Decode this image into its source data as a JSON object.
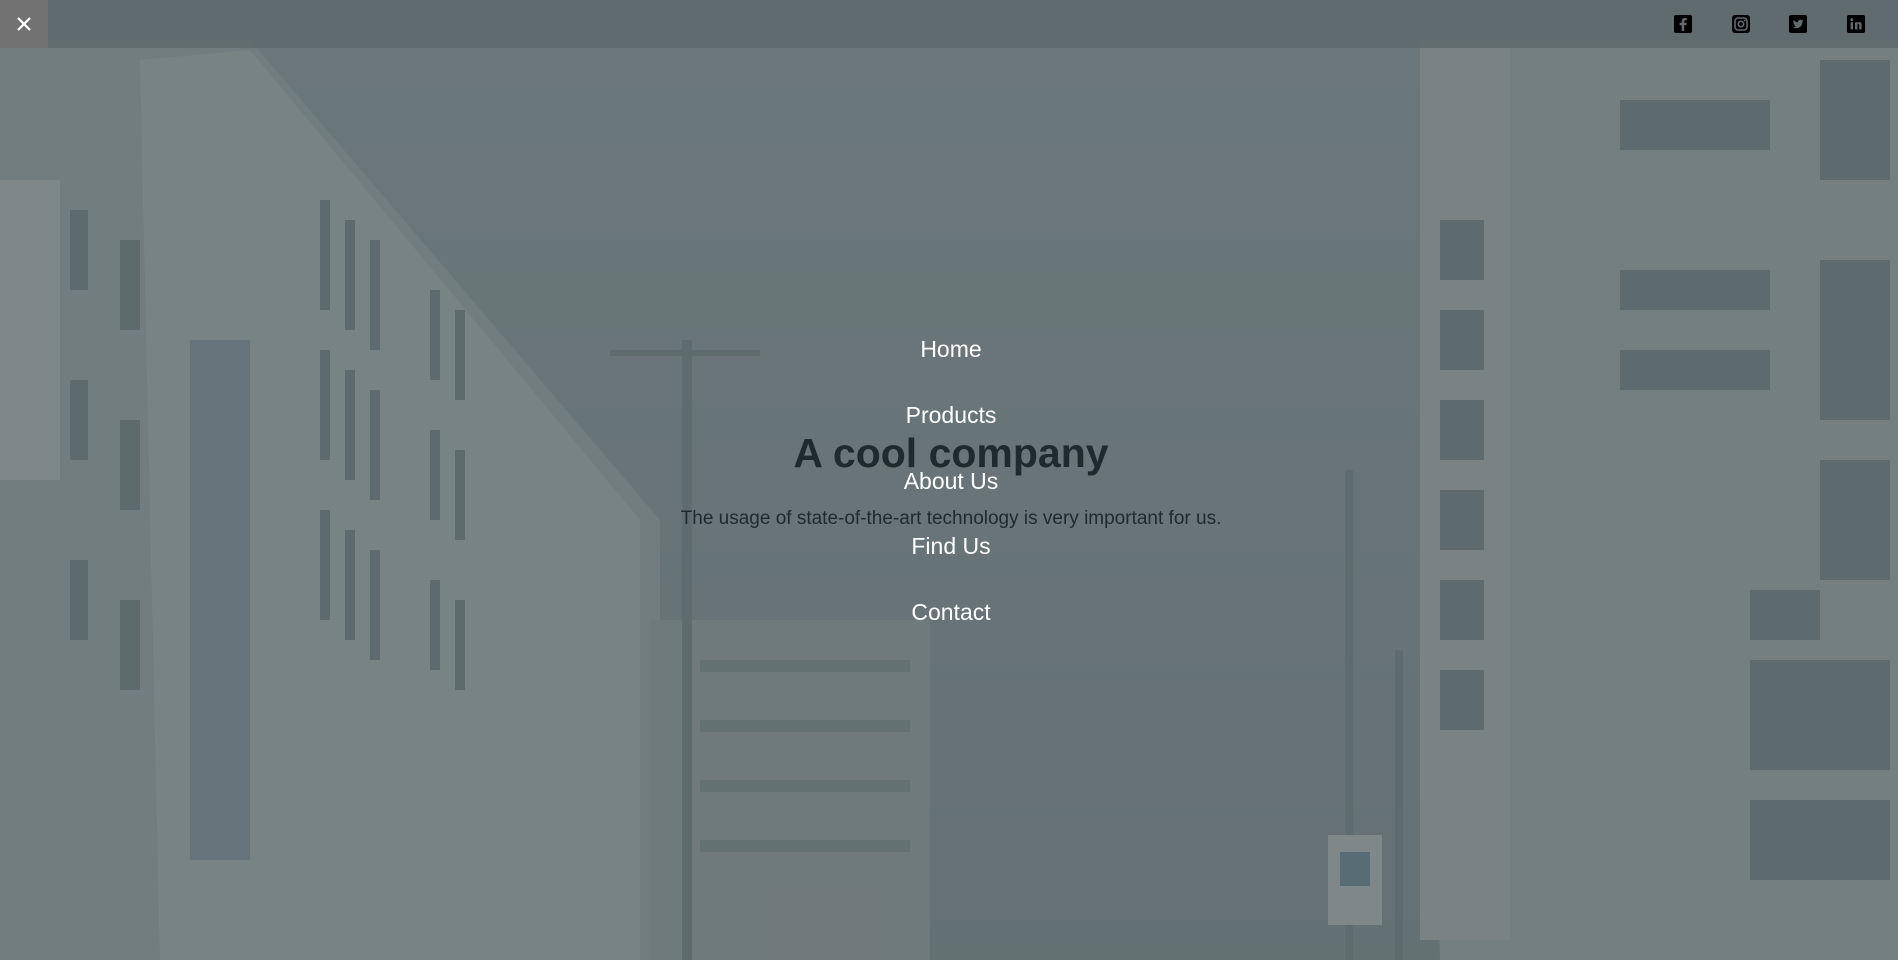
{
  "nav": {
    "close_label": "×",
    "items": [
      {
        "label": "Home"
      },
      {
        "label": "Products"
      },
      {
        "label": "About Us"
      },
      {
        "label": "Find Us"
      },
      {
        "label": "Contact"
      }
    ]
  },
  "social": {
    "icons": [
      "facebook-icon",
      "instagram-icon",
      "twitter-icon",
      "linkedin-icon"
    ]
  },
  "hero": {
    "title": "A cool company",
    "subtitle": "The usage of state-of-the-art technology is very important for us."
  },
  "colors": {
    "overlay": "#5f6b6e",
    "topbar": "#60696d",
    "menu_text": "#ffffff",
    "hero_text": "#1f2a2c"
  }
}
